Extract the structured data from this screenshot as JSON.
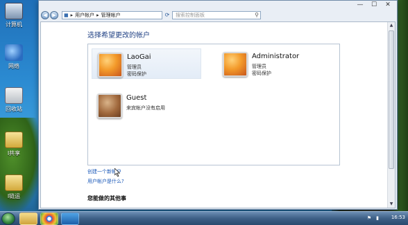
{
  "desktop": {
    "icons": [
      {
        "label": "计算机",
        "icon": "computer-icon"
      },
      {
        "label": "网络",
        "icon": "network-icon"
      },
      {
        "label": "回收站",
        "icon": "recycle-bin-icon"
      },
      {
        "label": "I共享",
        "icon": "shared-folder-icon"
      },
      {
        "label": "I链运",
        "icon": "folder-shortcut-icon"
      }
    ]
  },
  "window": {
    "caption_buttons": {
      "minimize": "—",
      "maximize": "☐",
      "close": "✕"
    },
    "address": {
      "crumbs": [
        "用户帐户",
        "管理帐户"
      ],
      "separator": "▸"
    },
    "search": {
      "placeholder": "搜索控制面板"
    },
    "page_title": "选择希望更改的帐户",
    "accounts": [
      {
        "name": "LaoGai",
        "lines": [
          "管理员",
          "密码保护"
        ],
        "picture": "orange-flower-avatar",
        "selected": true
      },
      {
        "name": "Administrator",
        "lines": [
          "管理员",
          "密码保护"
        ],
        "picture": "orange-flower-avatar",
        "selected": false
      },
      {
        "name": "Guest",
        "lines": [
          "来宾帐户没有启用"
        ],
        "picture": "briefcase-avatar",
        "selected": false
      }
    ],
    "links": {
      "create_account": "创建一个新帐户",
      "what_is_account": "用户帐户是什么?"
    },
    "section_heading": "您能做的其他事"
  },
  "taskbar": {
    "buttons": [
      "folder-icon",
      "chrome-icon",
      "media-center-icon"
    ],
    "clock": "16:53"
  }
}
